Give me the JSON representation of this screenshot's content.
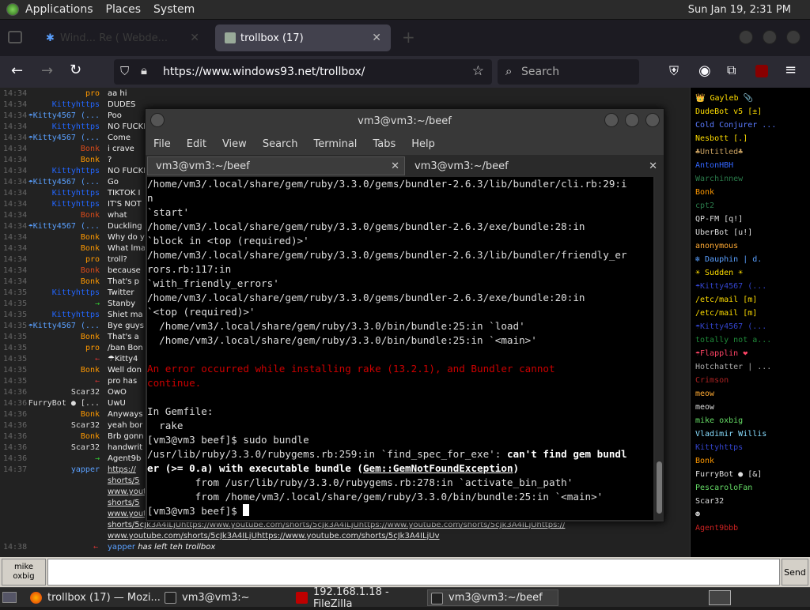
{
  "top_panel": {
    "menus": [
      "Applications",
      "Places",
      "System"
    ],
    "clock": "Sun Jan 19,  2:31 PM"
  },
  "browser": {
    "tabs": [
      {
        "label": "Wind... Re (  Webde...",
        "active": false
      },
      {
        "label": "trollbox (17)",
        "active": true
      }
    ],
    "url": "https://www.windows93.net/trollbox/",
    "search_placeholder": "Search"
  },
  "chat": {
    "rows": [
      {
        "time": "14:34",
        "nick": "pro",
        "nick_color": "#ff9900",
        "msg": "aa hi"
      },
      {
        "time": "14:34",
        "nick": "Kittyhttps",
        "nick_color": "#2266ff",
        "msg": "DUDES"
      },
      {
        "time": "14:34",
        "nick": "☂Kitty4567 (...",
        "nick_color": "#5aa0ff",
        "msg": "Poo"
      },
      {
        "time": "14:34",
        "nick": "Kittyhttps",
        "nick_color": "#2266ff",
        "msg": "NO FUCKI"
      },
      {
        "time": "14:34",
        "nick": "☂Kitty4567 (...",
        "nick_color": "#5aa0ff",
        "msg": "Come"
      },
      {
        "time": "14:34",
        "nick": "Bonk",
        "nick_color": "#d84a1a",
        "msg": "i crave"
      },
      {
        "time": "14:34",
        "nick": "Bonk",
        "nick_color": "#ff9900",
        "msg": "?"
      },
      {
        "time": "14:34",
        "nick": "Kittyhttps",
        "nick_color": "#2266ff",
        "msg": "NO FUCKI"
      },
      {
        "time": "14:34",
        "nick": "☂Kitty4567 (...",
        "nick_color": "#5aa0ff",
        "msg": "Go"
      },
      {
        "time": "14:34",
        "nick": "Kittyhttps",
        "nick_color": "#2266ff",
        "msg": "TIKTOK I"
      },
      {
        "time": "14:34",
        "nick": "Kittyhttps",
        "nick_color": "#2266ff",
        "msg": "IT'S NOT"
      },
      {
        "time": "14:34",
        "nick": "Bonk",
        "nick_color": "#d84a1a",
        "msg": "what"
      },
      {
        "time": "14:34",
        "nick": "☂Kitty4567 (...",
        "nick_color": "#5aa0ff",
        "msg": "Duckling"
      },
      {
        "time": "14:34",
        "nick": "Bonk",
        "nick_color": "#ff9900",
        "msg": "Why do y"
      },
      {
        "time": "14:34",
        "nick": "Bonk",
        "nick_color": "#ff9900",
        "msg": "What lma"
      },
      {
        "time": "14:34",
        "nick": "pro",
        "nick_color": "#ff9900",
        "msg": "troll?"
      },
      {
        "time": "14:34",
        "nick": "Bonk",
        "nick_color": "#d84a1a",
        "msg": "because"
      },
      {
        "time": "14:34",
        "nick": "Bonk",
        "nick_color": "#ff9900",
        "msg": "That's p"
      },
      {
        "time": "14:35",
        "nick": "Kittyhttps",
        "nick_color": "#2266ff",
        "msg": "Twitter"
      },
      {
        "time": "14:35",
        "nick": "→",
        "nick_color": "#33cc33",
        "msg": "Stanby"
      },
      {
        "time": "14:35",
        "nick": "Kittyhttps",
        "nick_color": "#2266ff",
        "msg": "Shiet ma"
      },
      {
        "time": "14:35",
        "nick": "☂Kitty4567 (...",
        "nick_color": "#5aa0ff",
        "msg": "Bye guys"
      },
      {
        "time": "14:35",
        "nick": "Bonk",
        "nick_color": "#ff9900",
        "msg": "That's a"
      },
      {
        "time": "14:35",
        "nick": "pro",
        "nick_color": "#ff9900",
        "msg": "/ban Bon"
      },
      {
        "time": "14:35",
        "nick": "←",
        "nick_color": "#cc3333",
        "msg": "☂Kitty4"
      },
      {
        "time": "14:35",
        "nick": "Bonk",
        "nick_color": "#ff9900",
        "msg": "Well don"
      },
      {
        "time": "14:35",
        "nick": "←",
        "nick_color": "#cc3333",
        "msg": "pro has"
      },
      {
        "time": "14:36",
        "nick": "Scar32",
        "nick_color": "#dddddd",
        "msg": "OwO"
      },
      {
        "time": "14:36",
        "nick": "FurryBot ● [...",
        "nick_color": "#dddddd",
        "msg": "UwU"
      },
      {
        "time": "14:36",
        "nick": "Bonk",
        "nick_color": "#ff9900",
        "msg": "Anyways"
      },
      {
        "time": "14:36",
        "nick": "Scar32",
        "nick_color": "#dddddd",
        "msg": "yeah bor"
      },
      {
        "time": "14:36",
        "nick": "Bonk",
        "nick_color": "#ff9900",
        "msg": "Brb gonn"
      },
      {
        "time": "14:36",
        "nick": "Scar32",
        "nick_color": "#dddddd",
        "msg": "handwrit"
      },
      {
        "time": "14:36",
        "nick": "→",
        "nick_color": "#33cc33",
        "msg": "Agent9b"
      },
      {
        "time": "14:37",
        "nick": "yapper",
        "nick_color": "#5aa0ff",
        "msg": "https://"
      }
    ],
    "link_lines": [
      "shorts/5",
      "www.yout",
      "shorts/5",
      "www.yout",
      "shorts/5cJk3A4ILjUhttps://www.youtube.com/shorts/5cJk3A4ILjUhttps://www.youtube.com/shorts/5cJk3A4ILjUhttps://",
      "www.youtube.com/shorts/5cJk3A4ILjUhttps://www.youtube.com/shorts/5cJk3A4ILjUv"
    ],
    "leave_line": {
      "time": "14:38",
      "arrow": "←",
      "nick": "yapper",
      "text": "has left teh trollbox"
    }
  },
  "userlist": [
    {
      "name": "👑 Gayleb 📎",
      "color": "#ffdd00"
    },
    {
      "name": "DudeBot v5 [±]",
      "color": "#ffdd00"
    },
    {
      "name": "Cold Conjurer ...",
      "color": "#5a7aff"
    },
    {
      "name": "Nesbott [.]",
      "color": "#ffdd00"
    },
    {
      "name": "♣Untitled♣",
      "color": "#c8a060"
    },
    {
      "name": "AntonHBH",
      "color": "#3366ff"
    },
    {
      "name": "Warchinnew",
      "color": "#2a7a4a"
    },
    {
      "name": "Bonk",
      "color": "#ff9900"
    },
    {
      "name": "cpt2",
      "color": "#2a7a4a"
    },
    {
      "name": "QP-FM [q!]",
      "color": "#dddddd"
    },
    {
      "name": "UberBot [u!]",
      "color": "#dddddd"
    },
    {
      "name": "anonymous",
      "color": "#ffaa33"
    },
    {
      "name": "❄ Dauphin | d.",
      "color": "#5aa0ff"
    },
    {
      "name": "☀ Sudden ☀",
      "color": "#ffdd00"
    },
    {
      "name": "☂Kitty4567 (...",
      "color": "#3344cc"
    },
    {
      "name": "/etc/mail [m]",
      "color": "#ffdd00"
    },
    {
      "name": "/etc/mail [m]",
      "color": "#ffdd00"
    },
    {
      "name": "☂Kitty4567 (...",
      "color": "#3344cc"
    },
    {
      "name": "totally not a...",
      "color": "#1f8a3a"
    },
    {
      "name": "☂Flapplin ❤",
      "color": "#ff4466"
    },
    {
      "name": "Hotchatter | ...",
      "color": "#aaaaaa"
    },
    {
      "name": "Crimson",
      "color": "#aa2222"
    },
    {
      "name": "meow",
      "color": "#ffaa33"
    },
    {
      "name": "meow",
      "color": "#dddddd"
    },
    {
      "name": "mike oxbig",
      "color": "#66dd66"
    },
    {
      "name": "Vladimir Willis",
      "color": "#88ddff"
    },
    {
      "name": "Kittyhttps",
      "color": "#3344cc"
    },
    {
      "name": "Bonk",
      "color": "#ff9900"
    },
    {
      "name": "FurryBot ● [&]",
      "color": "#dddddd"
    },
    {
      "name": "PescaroloFan",
      "color": "#66dd66"
    },
    {
      "name": "Scar32",
      "color": "#dddddd"
    },
    {
      "name": "☻",
      "color": "#dddddd"
    },
    {
      "name": "Agent9bbb",
      "color": "#cc2222"
    }
  ],
  "msgbar": {
    "user_line1": "mike",
    "user_line2": "oxbig",
    "send_label": "Send"
  },
  "terminal": {
    "title": "vm3@vm3:~/beef",
    "menu": [
      "File",
      "Edit",
      "View",
      "Search",
      "Terminal",
      "Tabs",
      "Help"
    ],
    "tabs": [
      "vm3@vm3:~/beef",
      "vm3@vm3:~/beef"
    ],
    "lines": [
      {
        "t": "/home/vm3/.local/share/gem/ruby/3.3.0/gems/bundler-2.6.3/lib/bundler/cli.rb:29:i",
        "c": ""
      },
      {
        "t": "n",
        "c": ""
      },
      {
        "t": "`start'",
        "c": ""
      },
      {
        "t": "/home/vm3/.local/share/gem/ruby/3.3.0/gems/bundler-2.6.3/exe/bundle:28:in",
        "c": ""
      },
      {
        "t": "`block in <top (required)>'",
        "c": ""
      },
      {
        "t": "/home/vm3/.local/share/gem/ruby/3.3.0/gems/bundler-2.6.3/lib/bundler/friendly_er",
        "c": ""
      },
      {
        "t": "rors.rb:117:in",
        "c": ""
      },
      {
        "t": "`with_friendly_errors'",
        "c": ""
      },
      {
        "t": "/home/vm3/.local/share/gem/ruby/3.3.0/gems/bundler-2.6.3/exe/bundle:20:in",
        "c": ""
      },
      {
        "t": "`<top (required)>'",
        "c": ""
      },
      {
        "t": "  /home/vm3/.local/share/gem/ruby/3.3.0/bin/bundle:25:in `load'",
        "c": ""
      },
      {
        "t": "  /home/vm3/.local/share/gem/ruby/3.3.0/bin/bundle:25:in `<main>'",
        "c": ""
      },
      {
        "t": "",
        "c": ""
      },
      {
        "t": "An error occurred while installing rake (13.2.1), and Bundler cannot",
        "c": "red"
      },
      {
        "t": "continue.",
        "c": "red"
      },
      {
        "t": "",
        "c": ""
      },
      {
        "t": "In Gemfile:",
        "c": ""
      },
      {
        "t": "  rake",
        "c": ""
      },
      {
        "t": "[vm3@vm3 beef]$ sudo bundle",
        "c": ""
      }
    ],
    "err_line1_a": "/usr/lib/ruby/3.3.0/rubygems.rb:259:in `find_spec_for_exe': ",
    "err_line1_b": "can't find gem bundl",
    "err_line2_a": "er (>= 0.a) with executable bundle (",
    "err_line2_link": "Gem::GemNotFoundException",
    "err_line2_b": ")",
    "from_line1": "        from /usr/lib/ruby/3.3.0/rubygems.rb:278:in `activate_bin_path'",
    "from_line2": "        from /home/vm3/.local/share/gem/ruby/3.3.0/bin/bundle:25:in `<main>'",
    "prompt": "[vm3@vm3 beef]$ "
  },
  "taskbar": {
    "items": [
      {
        "label": "trollbox (17) — Mozi...",
        "active": false
      },
      {
        "label": "vm3@vm3:~",
        "active": false
      },
      {
        "label": "192.168.1.18 - FileZilla",
        "active": false
      },
      {
        "label": "vm3@vm3:~/beef",
        "active": true
      }
    ]
  }
}
